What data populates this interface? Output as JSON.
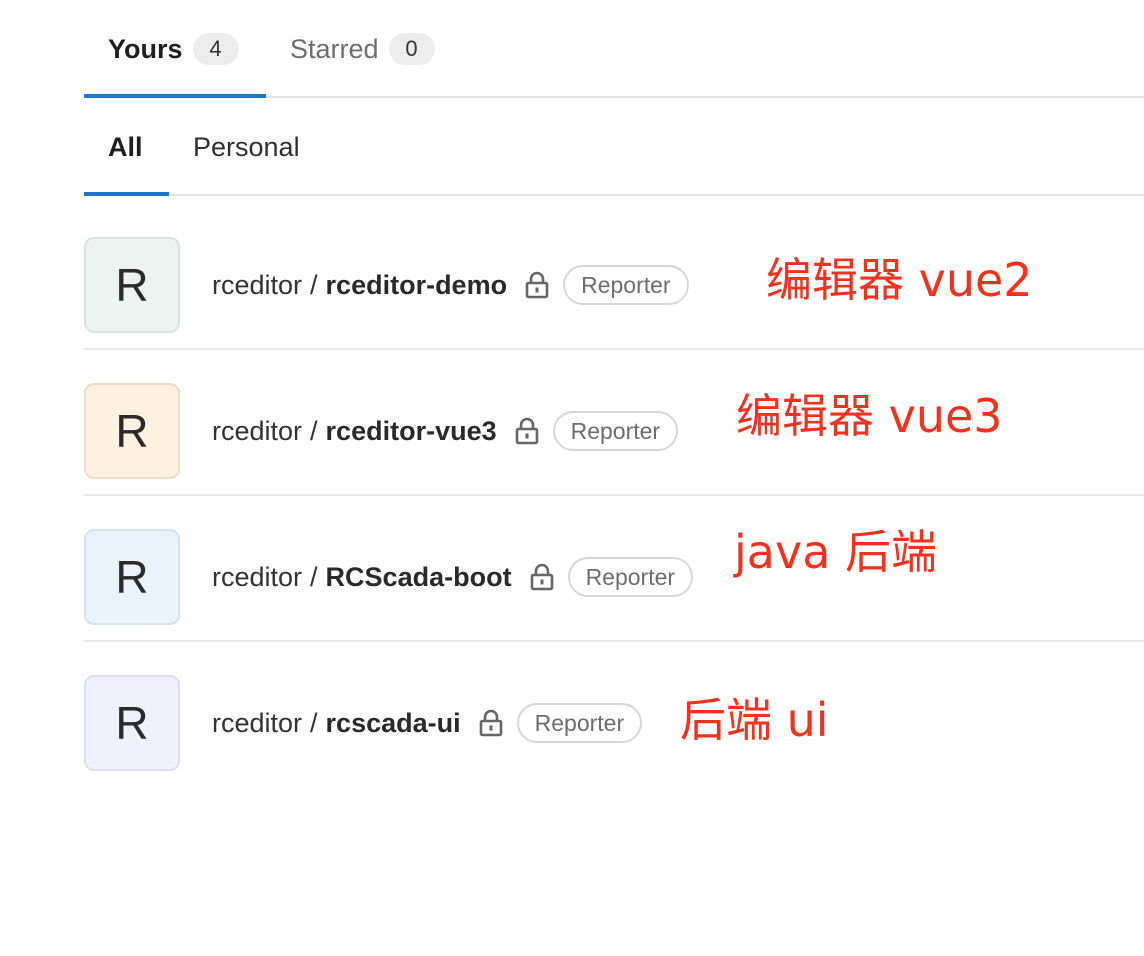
{
  "tabs": [
    {
      "label": "Yours",
      "count": "4",
      "active": true
    },
    {
      "label": "Starred",
      "count": "0",
      "active": false
    }
  ],
  "subtabs": [
    {
      "label": "All",
      "active": true
    },
    {
      "label": "Personal",
      "active": false
    }
  ],
  "projects": [
    {
      "namespace": "rceditor",
      "separator": "/",
      "name": "rceditor-demo",
      "avatar_letter": "R",
      "avatar_bg": "#edf3f0",
      "avatar_border": "#dbe3df",
      "role": "Reporter",
      "note": "编辑器 vue2"
    },
    {
      "namespace": "rceditor",
      "separator": "/",
      "name": "rceditor-vue3",
      "avatar_letter": "R",
      "avatar_bg": "#fdf1e0",
      "avatar_border": "#ecdcc8",
      "role": "Reporter",
      "note": "编辑器 vue3"
    },
    {
      "namespace": "rceditor",
      "separator": "/",
      "name": "RCScada-boot",
      "avatar_letter": "R",
      "avatar_bg": "#e9f3fc",
      "avatar_border": "#d4e1ee",
      "role": "Reporter",
      "note": "java 后端"
    },
    {
      "namespace": "rceditor",
      "separator": "/",
      "name": "rcscada-ui",
      "avatar_letter": "R",
      "avatar_bg": "#f1f0fd",
      "avatar_border": "#dedcf0",
      "role": "Reporter",
      "note": "后端 ui"
    }
  ],
  "icons": {
    "visibility": "lock-icon"
  },
  "colors": {
    "accent": "#1f75cb",
    "annotation": "#f0321e"
  }
}
